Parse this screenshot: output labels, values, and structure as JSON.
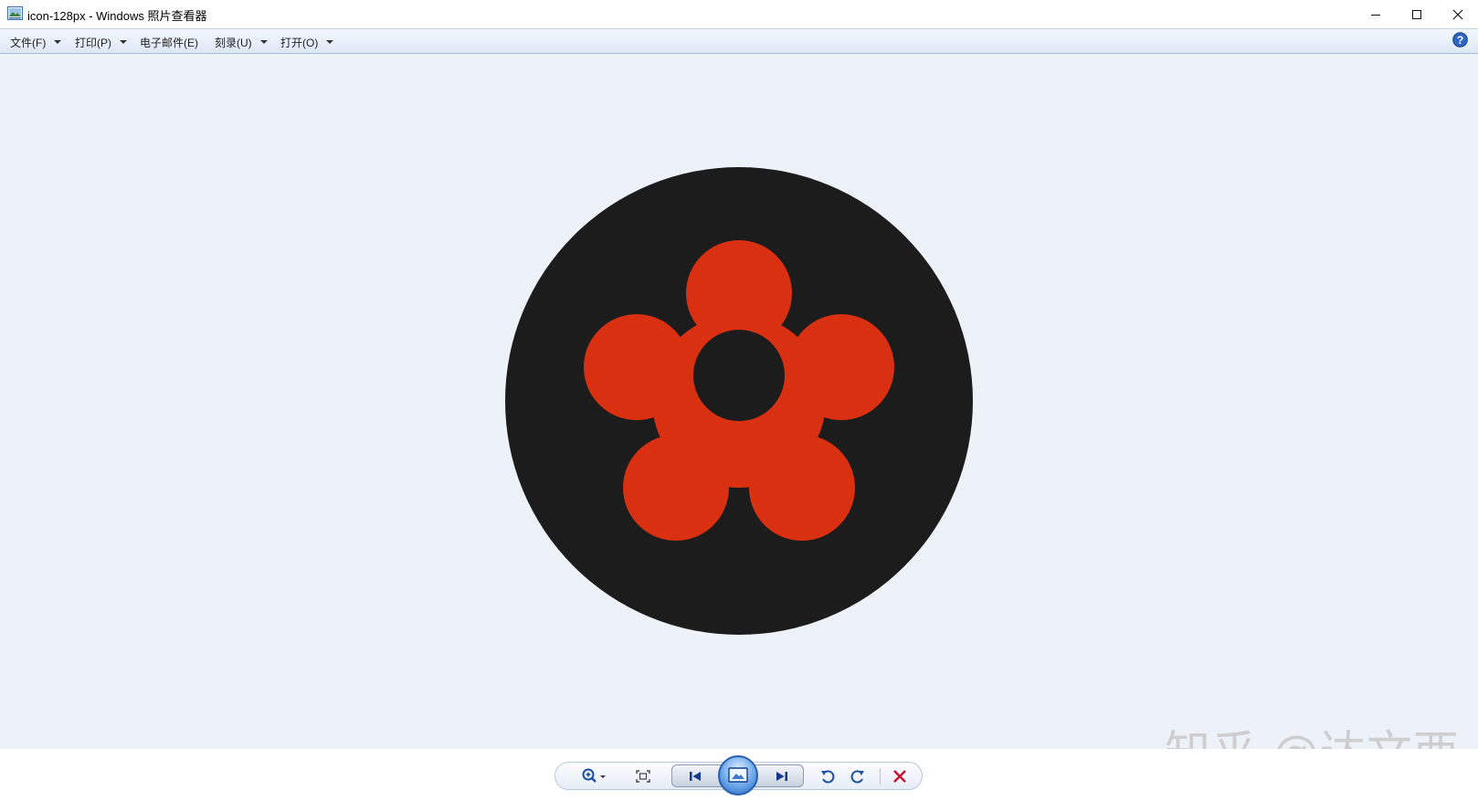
{
  "window": {
    "title": "icon-128px - Windows 照片查看器",
    "controls": {
      "minimize": "minimize-icon",
      "maximize": "maximize-icon",
      "close": "close-icon"
    }
  },
  "menu": {
    "items": [
      {
        "label": "文件(F)",
        "has_dropdown": true
      },
      {
        "label": "打印(P)",
        "has_dropdown": true
      },
      {
        "label": "电子邮件(E)",
        "has_dropdown": false
      },
      {
        "label": "刻录(U)",
        "has_dropdown": true
      },
      {
        "label": "打开(O)",
        "has_dropdown": true
      }
    ],
    "help_icon": "help-icon"
  },
  "image": {
    "circle_color": "#1c1c1c",
    "flower_color": "#d83011",
    "background_color": "#edf2f9"
  },
  "toolbar": {
    "buttons": [
      "zoom-icon",
      "fit-window-icon",
      "previous-icon",
      "slideshow-icon",
      "next-icon",
      "rotate-left-icon",
      "rotate-right-icon",
      "delete-icon"
    ]
  },
  "watermark": {
    "text": "知乎 @达文西"
  }
}
